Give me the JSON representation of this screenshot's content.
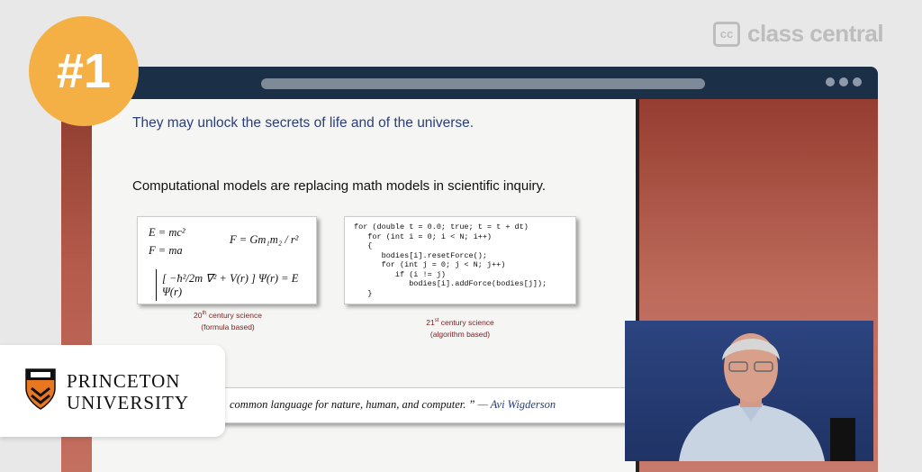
{
  "brand": {
    "logo_mark": "cc",
    "logo_text": "class central"
  },
  "badge": {
    "text": "#1",
    "color": "#f5b045"
  },
  "slide": {
    "quote_top": "They may unlock the secrets of life and of the universe.",
    "heading": "Computational models are replacing math models in scientific inquiry.",
    "formulas": {
      "line1": "E = mc²",
      "line2": "F = ma",
      "line3": "F = Gm₁m₂ / r²",
      "line4": "[ −ħ²/2m ∇² + V(r) ] Ψ(r) = E Ψ(r)"
    },
    "code": "for (double t = 0.0; true; t = t + dt)\n   for (int i = 0; i < N; i++)\n   {\n      bodies[i].resetForce();\n      for (int j = 0; j < N; j++)\n         if (i != j)\n            bodies[i].addForce(bodies[j]);\n   }",
    "caption1": {
      "ordinal": "20",
      "suffix": "th",
      "line1_rest": " century science",
      "line2": "(formula based)"
    },
    "caption2": {
      "ordinal": "21",
      "suffix": "st",
      "line1_rest": " century science",
      "line2": "(algorithm based)"
    },
    "bottom_quote": "common language for nature, human, and computer. ”",
    "bottom_quote_author": " — Avi Wigderson"
  },
  "institution": {
    "line1": "PRINCETON",
    "line2": "UNIVERSITY"
  },
  "icons": {
    "cc": "class-central-logo-icon",
    "shield": "princeton-shield-icon",
    "window_menu": "window-dots-icon",
    "presenter": "presenter-video"
  },
  "colors": {
    "window_bar": "#1b2f47",
    "slide_bg": "#f5f5f3",
    "side_bg": "#8e3c2f",
    "princeton_orange": "#e87722"
  }
}
